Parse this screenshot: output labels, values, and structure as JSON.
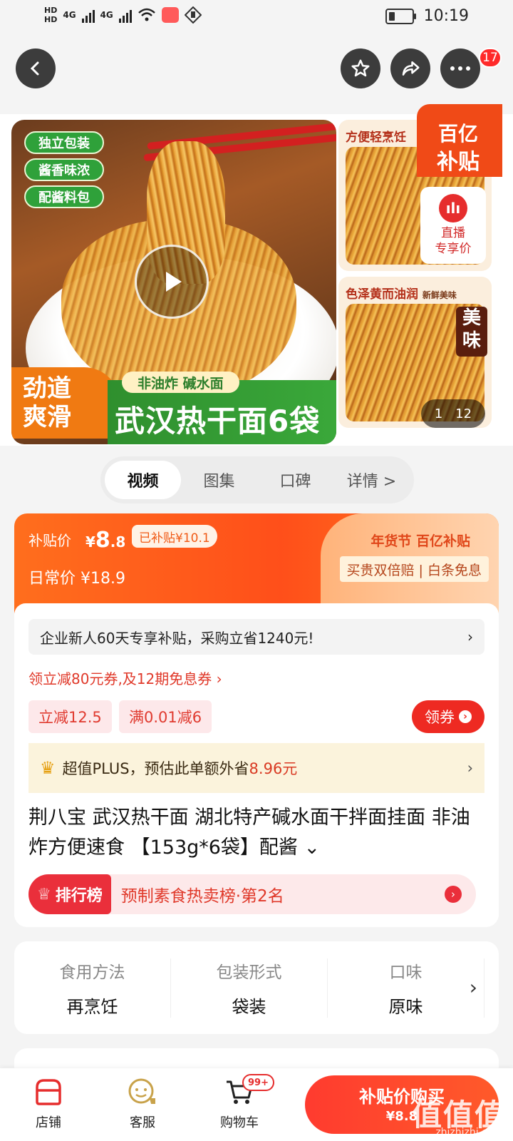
{
  "status": {
    "hd1": "HD",
    "hd2": "HD",
    "net1": "4G",
    "net2": "4G",
    "time": "10:19"
  },
  "nav": {
    "badge_count": "17"
  },
  "gallery": {
    "main_tags": [
      "独立包装",
      "酱香味浓",
      "配酱料包"
    ],
    "banner_left": "劲道\n爽滑",
    "banner_sub": "非油炸 碱水面",
    "banner_title": "武汉热干面6袋",
    "thumb1_title": "方便轻烹饪",
    "thumb2_title": "色泽黄而油润",
    "thumb2_sub": "新鲜美味",
    "meiwei": "美味",
    "subsidy_badge_line1": "百亿",
    "subsidy_badge_line2": "补贴",
    "live_line1": "直播",
    "live_line2": "专享价",
    "counter_current": "1",
    "counter_total": "12"
  },
  "tabs": [
    "视频",
    "图集",
    "口碑",
    "详情 >"
  ],
  "price": {
    "subsidy_label": "补贴价",
    "subsidy_currency": "¥",
    "subsidy_int": "8",
    "subsidy_dec": ".8",
    "subsidized_tag": "已补贴¥10.1",
    "daily_label": "日常价 ¥18.9",
    "brand": "年货节 百亿补贴",
    "guarantee": "买贵双倍赔 | 白条免息"
  },
  "promo": {
    "enterprise": "企业新人60天专享补贴，采购立省1240元!",
    "coupon_link": "领立减80元券,及12期免息券 ›",
    "chip1": "立减12.5",
    "chip2": "满0.01减6",
    "get_coupon": "领券",
    "plus_text": "超值PLUS，预估此单额外省",
    "plus_save": "8.96元"
  },
  "product": {
    "title": "荆八宝 武汉热干面 湖北特产碱水面干拌面挂面 非油炸方便速食 【153g*6袋】配酱",
    "rank_tag": "排行榜",
    "rank_text": "预制素食热卖榜·第2名"
  },
  "attributes": [
    {
      "k": "食用方法",
      "v": "再烹饪"
    },
    {
      "k": "包装形式",
      "v": "袋装"
    },
    {
      "k": "口味",
      "v": "原味"
    }
  ],
  "bottom": {
    "store": "店铺",
    "service": "客服",
    "cart": "购物车",
    "cart_badge": "99+",
    "buy_line1": "补贴价购买",
    "buy_line2": "¥8.8"
  },
  "watermark": {
    "main": "值值值",
    "sub": "zhizhizhi.com"
  },
  "colors": {
    "accent": "#ff4f1a",
    "red": "#ee2a22",
    "green": "#2fa13a"
  }
}
